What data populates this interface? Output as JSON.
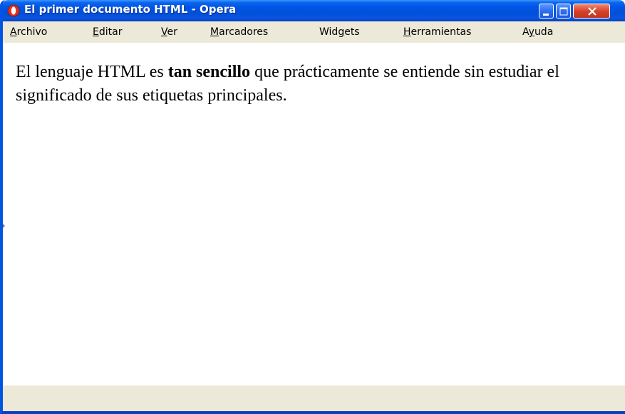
{
  "window": {
    "title": "El primer documento HTML - Opera",
    "app_icon": "opera-logo-icon",
    "controls": [
      "minimize-icon",
      "maximize-icon",
      "close-icon"
    ],
    "accent_color": "#0054e3",
    "close_color": "#d8432a"
  },
  "menu": {
    "items": [
      {
        "label_first": "A",
        "label_rest": "rchivo",
        "underline": "first"
      },
      {
        "label_first": "E",
        "label_rest": "ditar",
        "underline": "first"
      },
      {
        "label_first": "V",
        "label_rest": "er",
        "underline": "first"
      },
      {
        "label_first": "M",
        "label_rest": "arcadores",
        "underline": "first"
      },
      {
        "label_pre": "Wid",
        "label_ul": "g",
        "label_post": "ets"
      },
      {
        "label_first": "H",
        "label_rest": "erramientas",
        "underline": "first"
      },
      {
        "label_pre": "A",
        "label_ul": "y",
        "label_post": "uda"
      }
    ]
  },
  "page": {
    "text_before": "El lenguaje HTML es ",
    "text_bold": "tan sencillo",
    "text_after": " que prácticamente se entiende sin estudiar el significado de sus etiquetas principales."
  }
}
